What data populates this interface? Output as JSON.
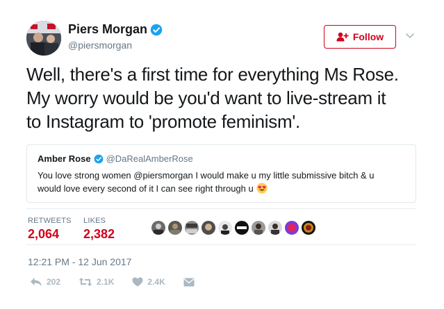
{
  "author": {
    "name": "Piers Morgan",
    "handle": "@piersmorgan",
    "verified": true
  },
  "follow_button": {
    "label": "Follow",
    "color": "#d0021b",
    "icon": "add-user-icon"
  },
  "tweet": {
    "lines": [
      "Well, there's a first time for everything Ms Rose.",
      "My worry would be you'd want to live-stream it",
      "to Instagram to 'promote feminism'."
    ]
  },
  "quoted_tweet": {
    "name": "Amber Rose",
    "handle": "@DaRealAmberRose",
    "verified": true,
    "line1": "You love strong women @piersmorgan I would make u my little submissive bitch & u",
    "line2": "would love every second of it I can see right through u",
    "emoji": "heart-eyes-emoji"
  },
  "stats": {
    "retweets_label": "RETWEETS",
    "retweets_value": "2,064",
    "likes_label": "LIKES",
    "likes_value": "2,382"
  },
  "likers_count_shown": 10,
  "timestamp": "12:21 PM - 12 Jun 2017",
  "actions": {
    "reply_count": "202",
    "retweet_count": "2.1K",
    "like_count": "2.4K"
  },
  "colors": {
    "accent": "#d0021b",
    "verified_blue": "#1da1f2",
    "muted": "#657786",
    "action_gray": "#aab8c2"
  }
}
